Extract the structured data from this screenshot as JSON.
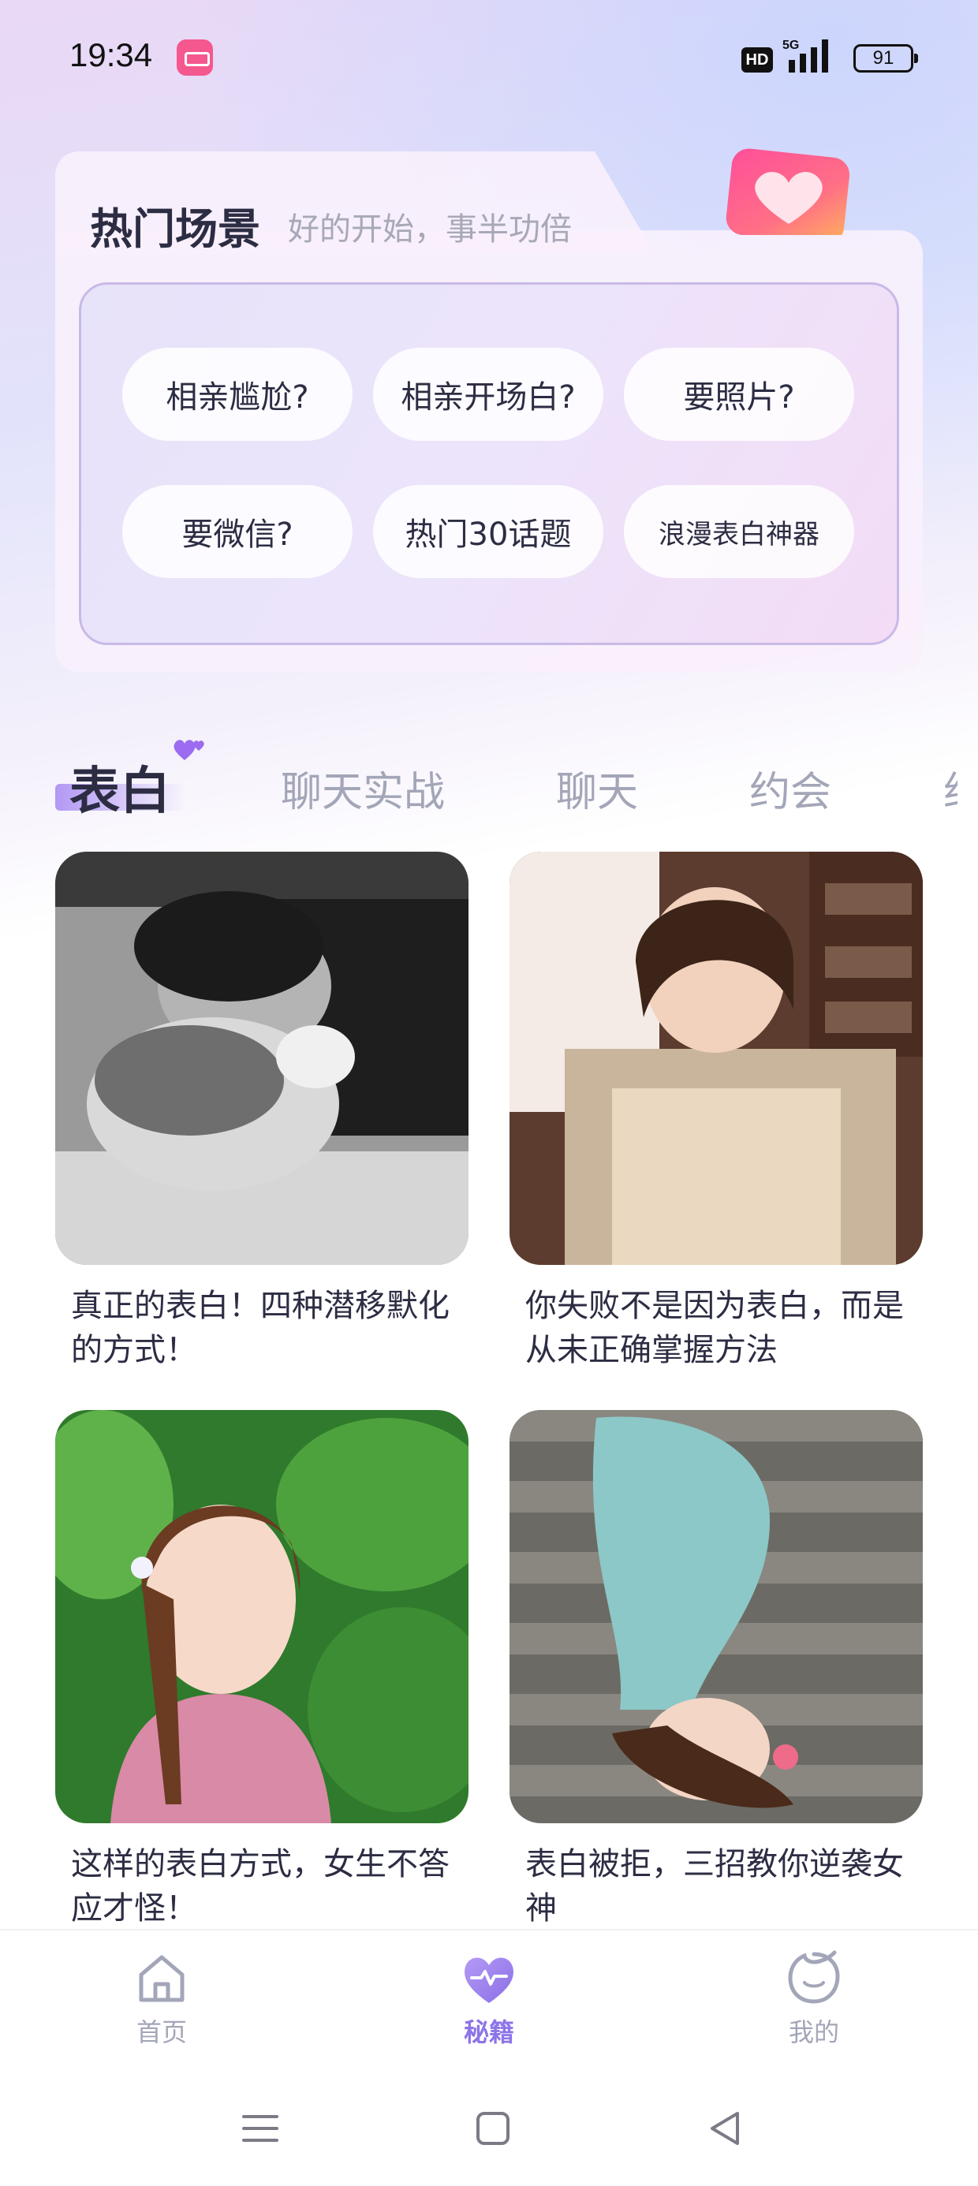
{
  "status_bar": {
    "time": "19:34",
    "hd": "HD",
    "network": "5G",
    "battery": "91"
  },
  "hot_scenes": {
    "title": "热门场景",
    "subtitle": "好的开始，事半功倍",
    "chips": [
      {
        "label": "相亲尴尬?"
      },
      {
        "label": "相亲开场白?"
      },
      {
        "label": "要照片?"
      },
      {
        "label": "要微信?"
      },
      {
        "label": "热门30话题"
      },
      {
        "label": "浪漫表白神器"
      }
    ]
  },
  "tabs": [
    {
      "label": "表白",
      "active": true
    },
    {
      "label": "聊天实战"
    },
    {
      "label": "聊天"
    },
    {
      "label": "约会"
    },
    {
      "label": "约"
    }
  ],
  "articles": [
    {
      "title": "真正的表白！四种潜移默化的方式！",
      "image": "black-and-white-couple-photo"
    },
    {
      "title": "你失败不是因为表白，而是从未正确掌握方法",
      "image": "short-hair-woman-apron-photo"
    },
    {
      "title": "这样的表白方式，女生不答应才怪！",
      "image": "smiling-woman-green-leaves-photo"
    },
    {
      "title": "表白被拒，三招教你逆袭女神",
      "image": "woman-lying-on-wood-deck-photo"
    }
  ],
  "bottom_nav": [
    {
      "label": "首页",
      "icon": "home-icon"
    },
    {
      "label": "秘籍",
      "icon": "heart-pulse-icon",
      "active": true
    },
    {
      "label": "我的",
      "icon": "profile-face-icon"
    }
  ],
  "colors": {
    "accent": "#8d74e8",
    "text_primary": "#2c2d43",
    "text_muted": "#a3a6b8",
    "heart_pink": "#f45a8c"
  }
}
